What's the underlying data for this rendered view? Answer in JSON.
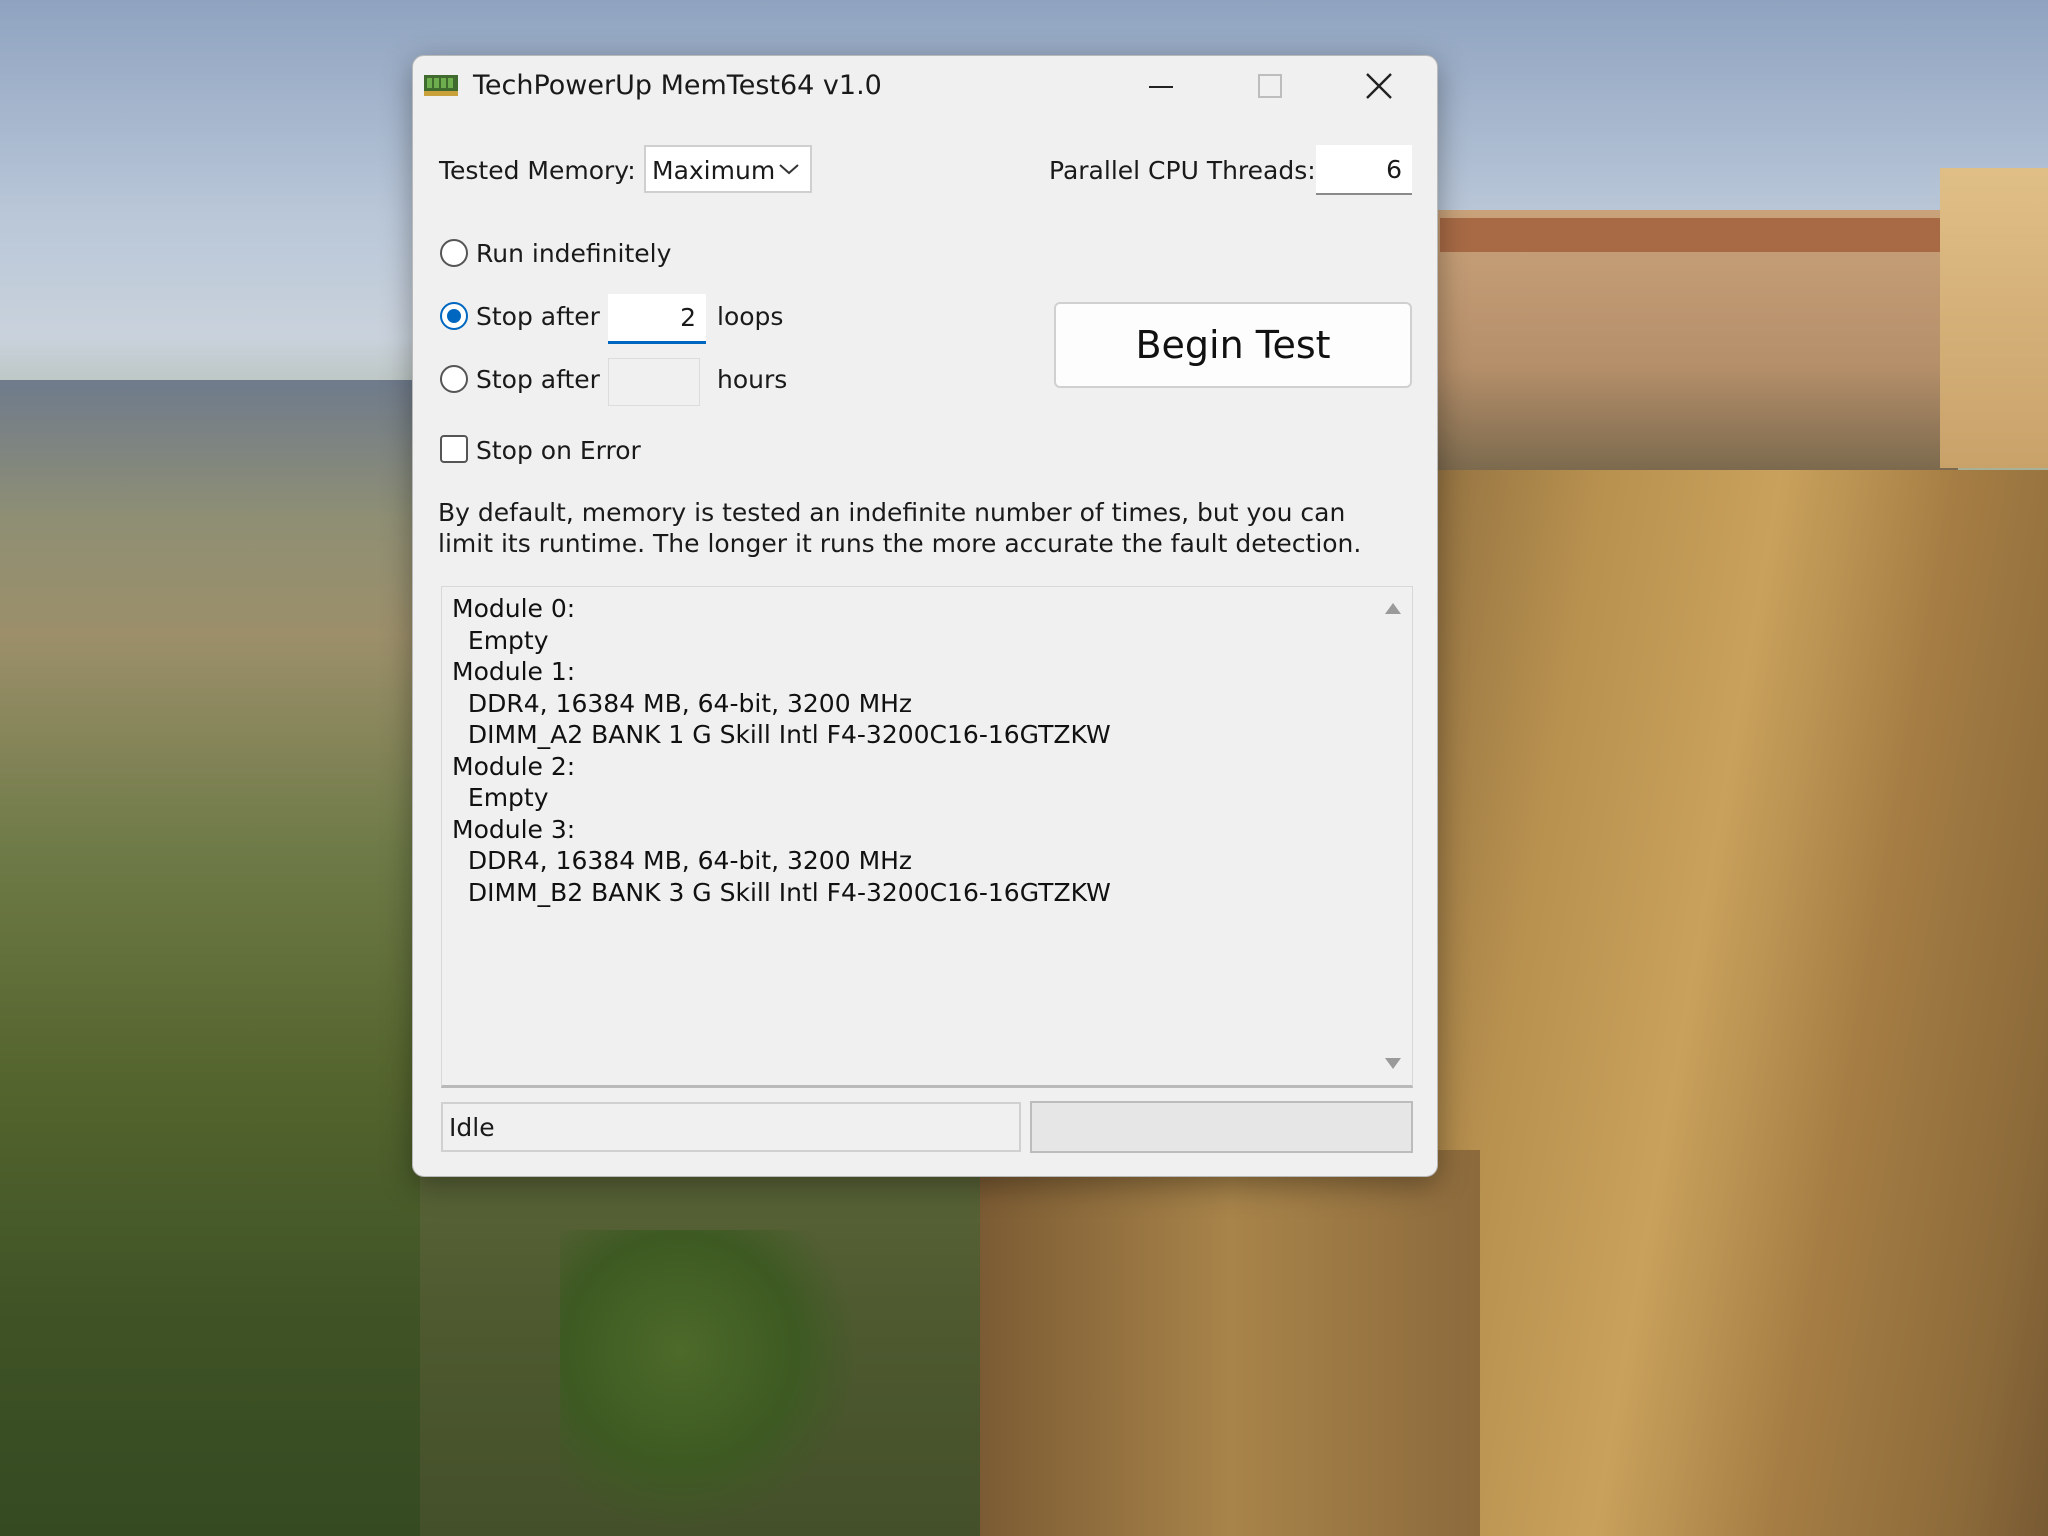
{
  "window": {
    "title": "TechPowerUp MemTest64 v1.0"
  },
  "controls": {
    "tested_memory_label": "Tested Memory:",
    "tested_memory_value": "Maximum",
    "threads_label": "Parallel CPU Threads:",
    "threads_value": "6",
    "run_indefinitely_label": "Run indefinitely",
    "stop_loops_label": "Stop after",
    "loops_value": "2",
    "loops_unit": "loops",
    "stop_hours_label": "Stop after",
    "hours_value": "",
    "hours_unit": "hours",
    "stop_on_error_label": "Stop on Error",
    "selected_mode": "stop_after_loops",
    "stop_on_error_checked": false,
    "begin_button_label": "Begin Test"
  },
  "description": "By default, memory is tested an indefinite number of times, but you can limit its runtime. The longer it runs the more accurate the fault detection.",
  "modules": [
    "Module 0:",
    "  Empty",
    "Module 1:",
    "  DDR4, 16384 MB, 64-bit, 3200 MHz",
    "  DIMM_A2 BANK 1 G Skill Intl F4-3200C16-16GTZKW",
    "Module 2:",
    "  Empty",
    "Module 3:",
    "  DDR4, 16384 MB, 64-bit, 3200 MHz",
    "  DIMM_B2 BANK 3 G Skill Intl F4-3200C16-16GTZKW"
  ],
  "status": {
    "text": "Idle",
    "progress": 0
  },
  "icons": {
    "app": "memory-module-icon",
    "dropdown": "chevron-down-icon",
    "close": "close-icon",
    "minimize": "minimize-icon",
    "maximize": "maximize-icon"
  },
  "colors": {
    "accent": "#0067c0",
    "window_bg": "#f0f0f0",
    "progress": "#06b025"
  }
}
